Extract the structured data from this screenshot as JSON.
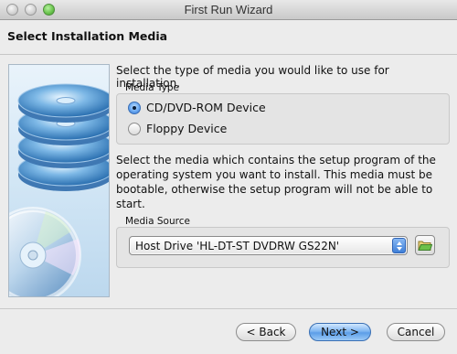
{
  "window": {
    "title": "First Run Wizard"
  },
  "page": {
    "title": "Select Installation Media",
    "intro_text": "Select the type of media you would like to use for installation."
  },
  "media_type": {
    "group_label": "Media Type",
    "options": [
      {
        "label": "CD/DVD-ROM Device",
        "selected": true
      },
      {
        "label": "Floppy Device",
        "selected": false
      }
    ]
  },
  "media_source": {
    "description": "Select the media which contains the setup program of the operating system you want to install. This media must be bootable, otherwise the setup program will not be able to start.",
    "group_label": "Media Source",
    "selected_value": "Host Drive 'HL-DT-ST DVDRW  GS22N'"
  },
  "buttons": {
    "back": "< Back",
    "next": "Next >",
    "cancel": "Cancel"
  },
  "colors": {
    "accent": "#5c9ee8",
    "window_bg": "#ececec"
  },
  "icons": {
    "folder": "folder-open-icon",
    "combo_arrow": "updown-arrows-icon"
  }
}
